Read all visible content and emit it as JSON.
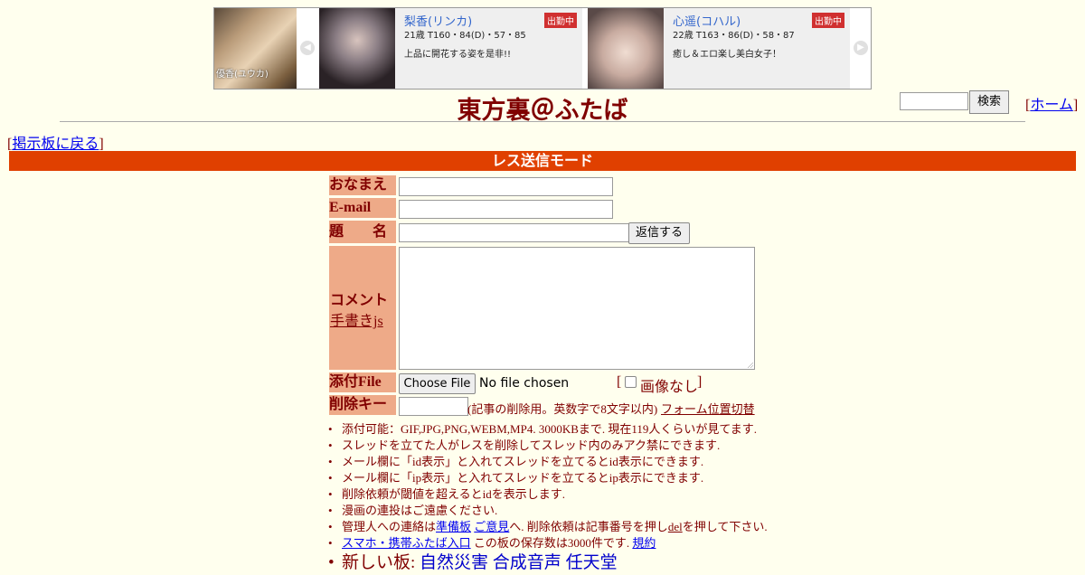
{
  "banner": {
    "thumb_caption": "優香(ユウカ)",
    "prev_arrow": "◀",
    "next_arrow": "▶",
    "cards": [
      {
        "name": "梨香(リンカ)",
        "badge": "出勤中",
        "spec": "21歳 T160・84(D)・57・85",
        "catch": "上品に開花する姿を是非!!"
      },
      {
        "name": "心遥(コハル)",
        "badge": "出勤中",
        "spec": "22歳 T163・86(D)・58・87",
        "catch": "癒し＆エロ楽し美白女子！"
      }
    ]
  },
  "header": {
    "title": "東方裏＠ふたば",
    "search_label": "検索",
    "home_open": "[",
    "home_label": "ホーム",
    "home_close": "]"
  },
  "nav": {
    "back_open": "[",
    "back_label": "掲示板に戻る",
    "back_close": "]"
  },
  "mode": "レス送信モード",
  "form": {
    "name_label": "おなまえ",
    "email_label": "E-mail",
    "subject_label": "題　　名",
    "submit_label": "返信する",
    "comment_label": "コメント",
    "handwrite_label": "手書きjs",
    "file_label": "添付File",
    "choose_file": "Choose File",
    "no_file": "No file chosen",
    "noimage_open": "[",
    "noimage_label": "画像なし",
    "noimage_close": "]",
    "delkey_label": "削除キー",
    "delkey_note": "(記事の削除用。英数字で8文字以内)",
    "form_toggle": "フォーム位置切替"
  },
  "notes": {
    "n1": "添付可能：GIF,JPG,PNG,WEBM,MP4. 3000KBまで. 現在119人くらいが見てます.",
    "n2": "スレッドを立てた人がレスを削除してスレッド内のみアク禁にできます.",
    "n3": "メール欄に「id表示」と入れてスレッドを立てるとid表示にできます.",
    "n4": "メール欄に「ip表示」と入れてスレッドを立てるとip表示にできます.",
    "n5": "削除依頼が閾値を超えるとidを表示します.",
    "n6": "漫画の連投はご遠慮ください.",
    "n7_pre": "管理人への連絡は",
    "n7_link1": "準備板",
    "n7_link2": "ご意見",
    "n7_mid": "へ. 削除依頼は記事番号を押し",
    "n7_link3": "del",
    "n7_post": "を押して下さい.",
    "n8_link": "スマホ・携帯ふたば入口",
    "n8_text": " この板の保存数は3000件です. ",
    "n8_link2": "規約",
    "n9_label": "新しい板: ",
    "n9_boards": [
      "自然災害",
      "合成音声",
      "任天堂"
    ]
  }
}
